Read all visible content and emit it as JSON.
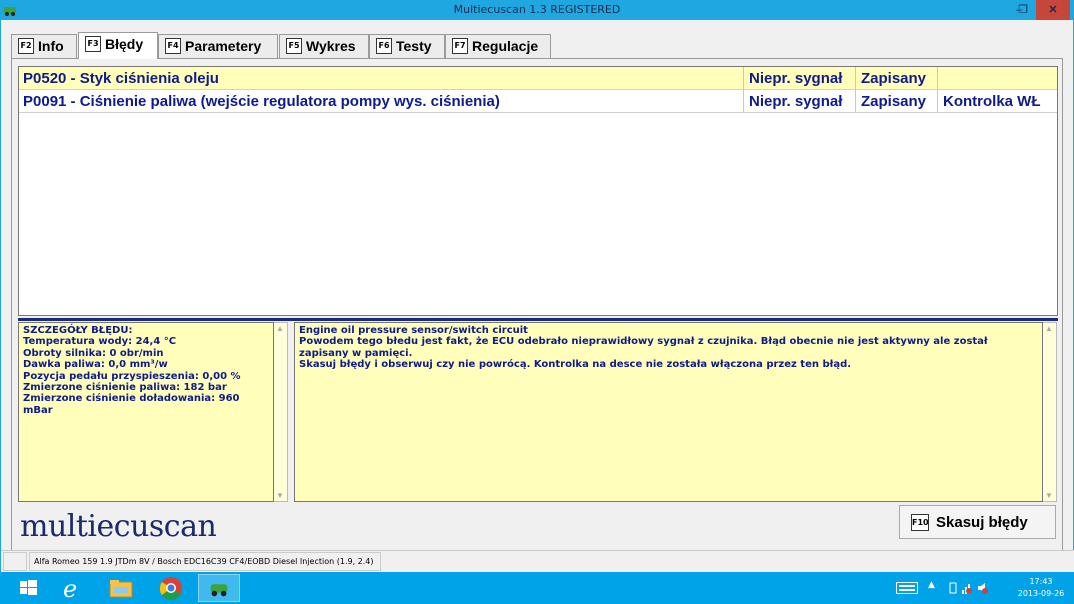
{
  "window": {
    "title": "Multiecuscan 1.3 REGISTERED",
    "minimize": "–",
    "maximize": "❐",
    "close": "✕"
  },
  "tabs": [
    {
      "key": "F2",
      "label": "Info"
    },
    {
      "key": "F3",
      "label": "Błędy",
      "active": true
    },
    {
      "key": "F4",
      "label": "Parametery"
    },
    {
      "key": "F5",
      "label": "Wykres"
    },
    {
      "key": "F6",
      "label": "Testy"
    },
    {
      "key": "F7",
      "label": "Regulacje"
    }
  ],
  "errors": [
    {
      "code": "P0520 - Styk ciśnienia oleju",
      "signal": "Niepr. sygnał",
      "status": "Zapisany",
      "lamp": ""
    },
    {
      "code": "P0091 - Ciśnienie paliwa (wejście regulatora pompy wys. ciśnienia)",
      "signal": "Niepr. sygnał",
      "status": "Zapisany",
      "lamp": "Kontrolka WŁ"
    }
  ],
  "details": {
    "lines": [
      "SZCZEGÓŁY BŁĘDU:",
      "Temperatura wody: 24,4 °C",
      "Obroty silnika: 0 obr/min",
      "Dawka paliwa: 0,0 mm³/w",
      "Pozycja pedału przyspieszenia: 0,00 %",
      "Zmierzone ciśnienie paliwa: 182 bar",
      "Zmierzone ciśnienie doładowania: 960 mBar"
    ]
  },
  "description": {
    "lines": [
      "Engine oil pressure sensor/switch circuit",
      "Powodem tego błedu jest fakt, że ECU odebrało nieprawidłowy sygnał z czujnika. Błąd obecnie nie jest aktywny ale został zapisany w pamięci.",
      "Skasuj błędy i obserwuj czy nie powrócą. Kontrolka na desce nie została włączona przez ten błąd."
    ]
  },
  "logo": "multiecuscan",
  "clear_button": {
    "key": "F10",
    "label": "Skasuj błędy"
  },
  "statusbar": {
    "vehicle": "Alfa Romeo 159 1.9 JTDm 8V / Bosch EDC16C39 CF4/EOBD Diesel Injection (1.9, 2.4)"
  },
  "taskbar": {
    "time": "17:43",
    "date": "2013-09-26"
  },
  "colors": {
    "accent": "#00a2e8",
    "error_text": "#0d1b8c",
    "highlight": "#ffffbb",
    "close_button": "#c7463b"
  }
}
